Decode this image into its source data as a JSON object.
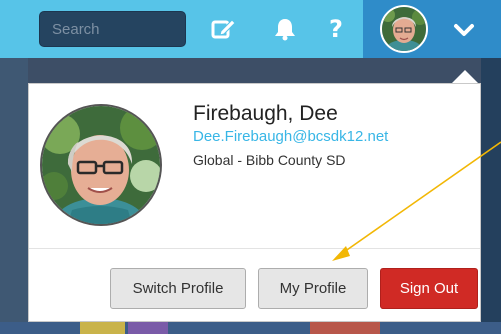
{
  "topbar": {
    "search": {
      "value": "",
      "placeholder": "Search"
    },
    "icons": [
      "edit-icon",
      "bell-icon",
      "help-icon"
    ],
    "help_glyph": "?",
    "user_menu_chevron": "chevron-down-icon"
  },
  "profile": {
    "name": "Firebaugh, Dee",
    "email": "Dee.Firebaugh@bcsdk12.net",
    "organization": "Global - Bibb County SD"
  },
  "actions": {
    "switch_profile": "Switch Profile",
    "my_profile": "My Profile",
    "sign_out": "Sign Out"
  },
  "colors": {
    "topbar": "#57c4e8",
    "user_tab": "#2f8cc9",
    "search_bg": "#254460",
    "email_link": "#38b6e6",
    "sign_out": "#d02a25",
    "annotation_arrow": "#f2b705"
  }
}
